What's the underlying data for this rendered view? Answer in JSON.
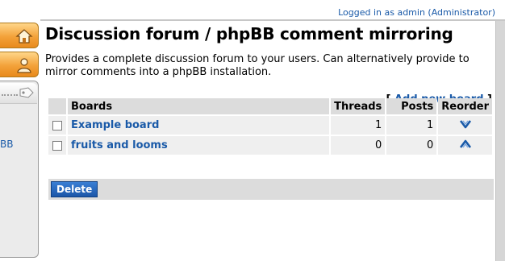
{
  "header": {
    "login_text": "Logged in as admin  (Administrator)"
  },
  "sidebar": {
    "partial_link": "BB",
    "tabs": [
      "home-icon",
      "users-icon"
    ],
    "panel_icon": "tag-icon"
  },
  "page": {
    "title": "Discussion forum / phpBB comment mirroring",
    "description": "Provides a complete discussion forum to your users. Can alternatively provide to mirror comments into a phpBB installation.",
    "add_new_board_prefix": "[ ",
    "add_new_board_label": "Add new board",
    "add_new_board_suffix": " ]"
  },
  "table": {
    "columns": {
      "boards": "Boards",
      "threads": "Threads",
      "posts": "Posts",
      "reorder": "Reorder"
    },
    "rows": [
      {
        "name": "Example board",
        "threads": "1",
        "posts": "1",
        "reorder": "down"
      },
      {
        "name": "fruits and looms",
        "threads": "0",
        "posts": "0",
        "reorder": "up"
      }
    ],
    "delete_label": "Delete"
  },
  "colors": {
    "link": "#1a5aa8",
    "tab_orange": "#f3a23a",
    "header_gray": "#dcdcdc",
    "row_gray": "#efefef"
  }
}
